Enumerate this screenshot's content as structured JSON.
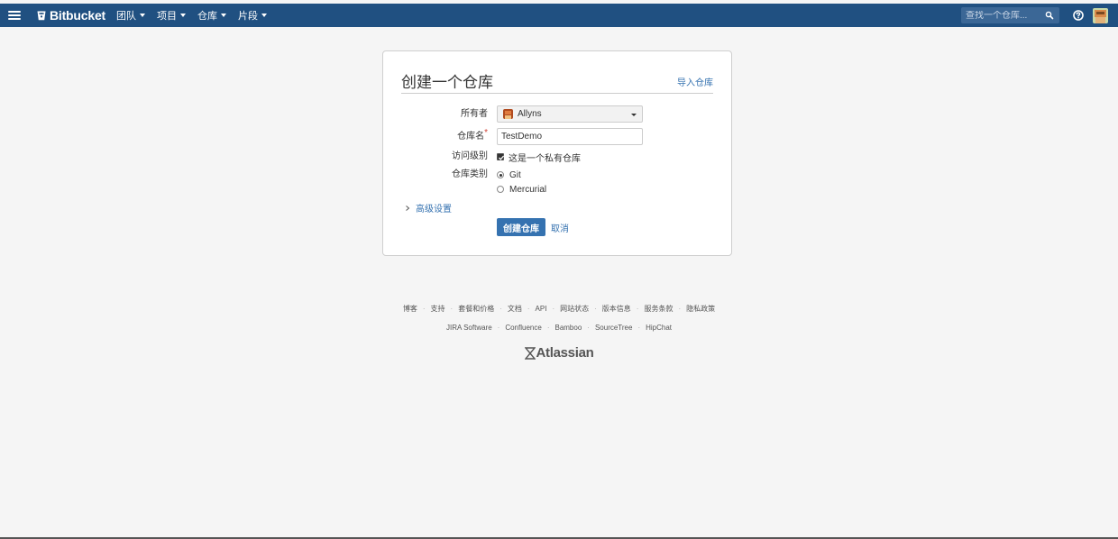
{
  "header": {
    "brand": "Bitbucket",
    "nav": [
      "团队",
      "项目",
      "仓库",
      "片段"
    ],
    "search_placeholder": "查找一个仓库...",
    "icons": {
      "menu": "hamburger-icon",
      "logo": "bitbucket-icon",
      "search": "search-icon",
      "help": "help-icon"
    },
    "color": "#205081"
  },
  "form": {
    "title": "创建一个仓库",
    "import_link": "导入仓库",
    "owner_label": "所有者",
    "owner_value": "Allyns",
    "repo_name_label": "仓库名",
    "required_mark": "*",
    "repo_name_value": "TestDemo",
    "access_label": "访问级别",
    "private_label": "这是一个私有仓库",
    "private_checked": true,
    "type_label": "仓库类别",
    "type_options": [
      "Git",
      "Mercurial"
    ],
    "type_selected": "Git",
    "advanced_label": "高级设置",
    "submit_label": "创建仓库",
    "cancel_label": "取消",
    "primary_color": "#3572b0"
  },
  "footer": {
    "links_row1": [
      "博客",
      "支持",
      "套餐和价格",
      "文档",
      "API",
      "网站状态",
      "版本信息",
      "服务条款",
      "隐私政策"
    ],
    "links_row2": [
      "JIRA Software",
      "Confluence",
      "Bamboo",
      "SourceTree",
      "HipChat"
    ],
    "brand": "Atlassian"
  }
}
